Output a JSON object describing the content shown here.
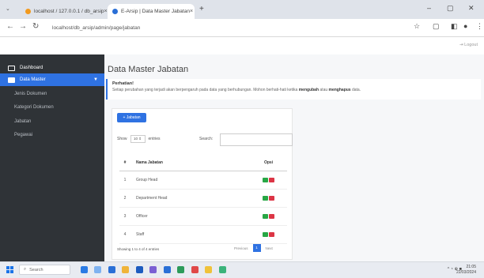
{
  "browser": {
    "tabs": [
      {
        "title": "localhost / 127.0.0.1 / db_arsip",
        "close": "×"
      },
      {
        "title": "E-Arsip | Data Master Jabatan",
        "close": "×"
      }
    ],
    "tab_dropdown": "⌄",
    "new_tab": "+",
    "url": "localhost/db_arsip/admin/page/jabatan",
    "window_controls": {
      "minimize": "–",
      "maximize": "▢",
      "close": "✕"
    }
  },
  "header": {
    "logout": "⇥ Logout"
  },
  "sidebar": {
    "dashboard": "Dashboard",
    "data_master": "Data Master",
    "items": [
      "Jenis Dokumen",
      "Kategori Dokumen",
      "Jabatan",
      "Pegawai"
    ]
  },
  "main": {
    "title": "Data Master Jabatan",
    "alert": {
      "heading": "Perhatian!",
      "text_pre": "Setiap perubahan yang terjadi akan berpengaruh pada data yang berhubungan. Mohon berhati-hati ketika ",
      "text_b1": "mengubah",
      "text_mid": " atau ",
      "text_b2": "menghapus",
      "text_post": " data."
    },
    "add_button": "+ Jabatan",
    "show": "Show",
    "entries_value": "10 ⇕",
    "entries": "entries",
    "search_label": "Search:",
    "columns": {
      "no": "#",
      "name": "Nama Jabatan",
      "action": "Opsi"
    },
    "rows": [
      {
        "no": "1",
        "name": "Group Head"
      },
      {
        "no": "2",
        "name": "Department Head"
      },
      {
        "no": "3",
        "name": "Officer"
      },
      {
        "no": "4",
        "name": "Staff"
      }
    ],
    "info": "Showing 1 to 4 of 4 entries",
    "pager": {
      "prev": "Previous",
      "page": "1",
      "next": "Next"
    }
  },
  "taskbar": {
    "search": "Search",
    "clock_time": "21:05",
    "clock_date": "22/03/2024",
    "tray": "^ ◔ ⊕ ■"
  }
}
